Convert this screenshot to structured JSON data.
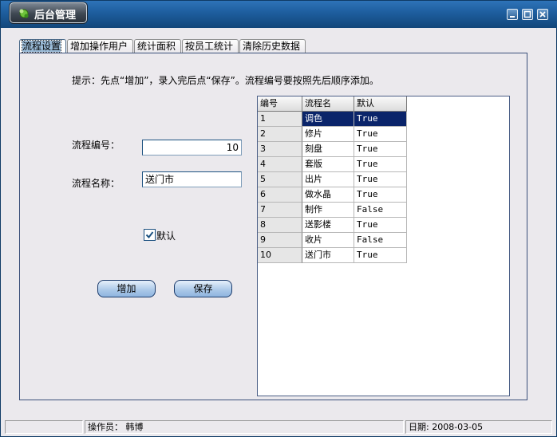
{
  "window": {
    "title": "后台管理"
  },
  "tabs": [
    {
      "label": "流程设置",
      "active": true
    },
    {
      "label": "增加操作用户",
      "active": false
    },
    {
      "label": "统计面积",
      "active": false
    },
    {
      "label": "按员工统计",
      "active": false
    },
    {
      "label": "清除历史数据",
      "active": false
    }
  ],
  "hint": "提示：先点“增加”，录入完后点“保存”。流程编号要按照先后顺序添加。",
  "form": {
    "flow_no_label": "流程编号：",
    "flow_no_value": "10",
    "flow_name_label": "流程名称：",
    "flow_name_value": "送门市",
    "default_label": "默认",
    "default_checked": true
  },
  "buttons": {
    "add": "增加",
    "save": "保存"
  },
  "grid": {
    "columns": [
      "编号",
      "流程名",
      "默认"
    ],
    "rows": [
      [
        "1",
        "调色",
        "True"
      ],
      [
        "2",
        "修片",
        "True"
      ],
      [
        "3",
        "刻盘",
        "True"
      ],
      [
        "4",
        "套版",
        "True"
      ],
      [
        "5",
        "出片",
        "True"
      ],
      [
        "6",
        "做水晶",
        "True"
      ],
      [
        "7",
        "制作",
        "False"
      ],
      [
        "8",
        "送影楼",
        "True"
      ],
      [
        "9",
        "收片",
        "False"
      ],
      [
        "10",
        "送门市",
        "True"
      ]
    ],
    "selected_row": 0,
    "selection_color": "#0a246a"
  },
  "statusbar": {
    "operator": "操作员： 韩博",
    "date": "日期:  2008-03-05"
  }
}
